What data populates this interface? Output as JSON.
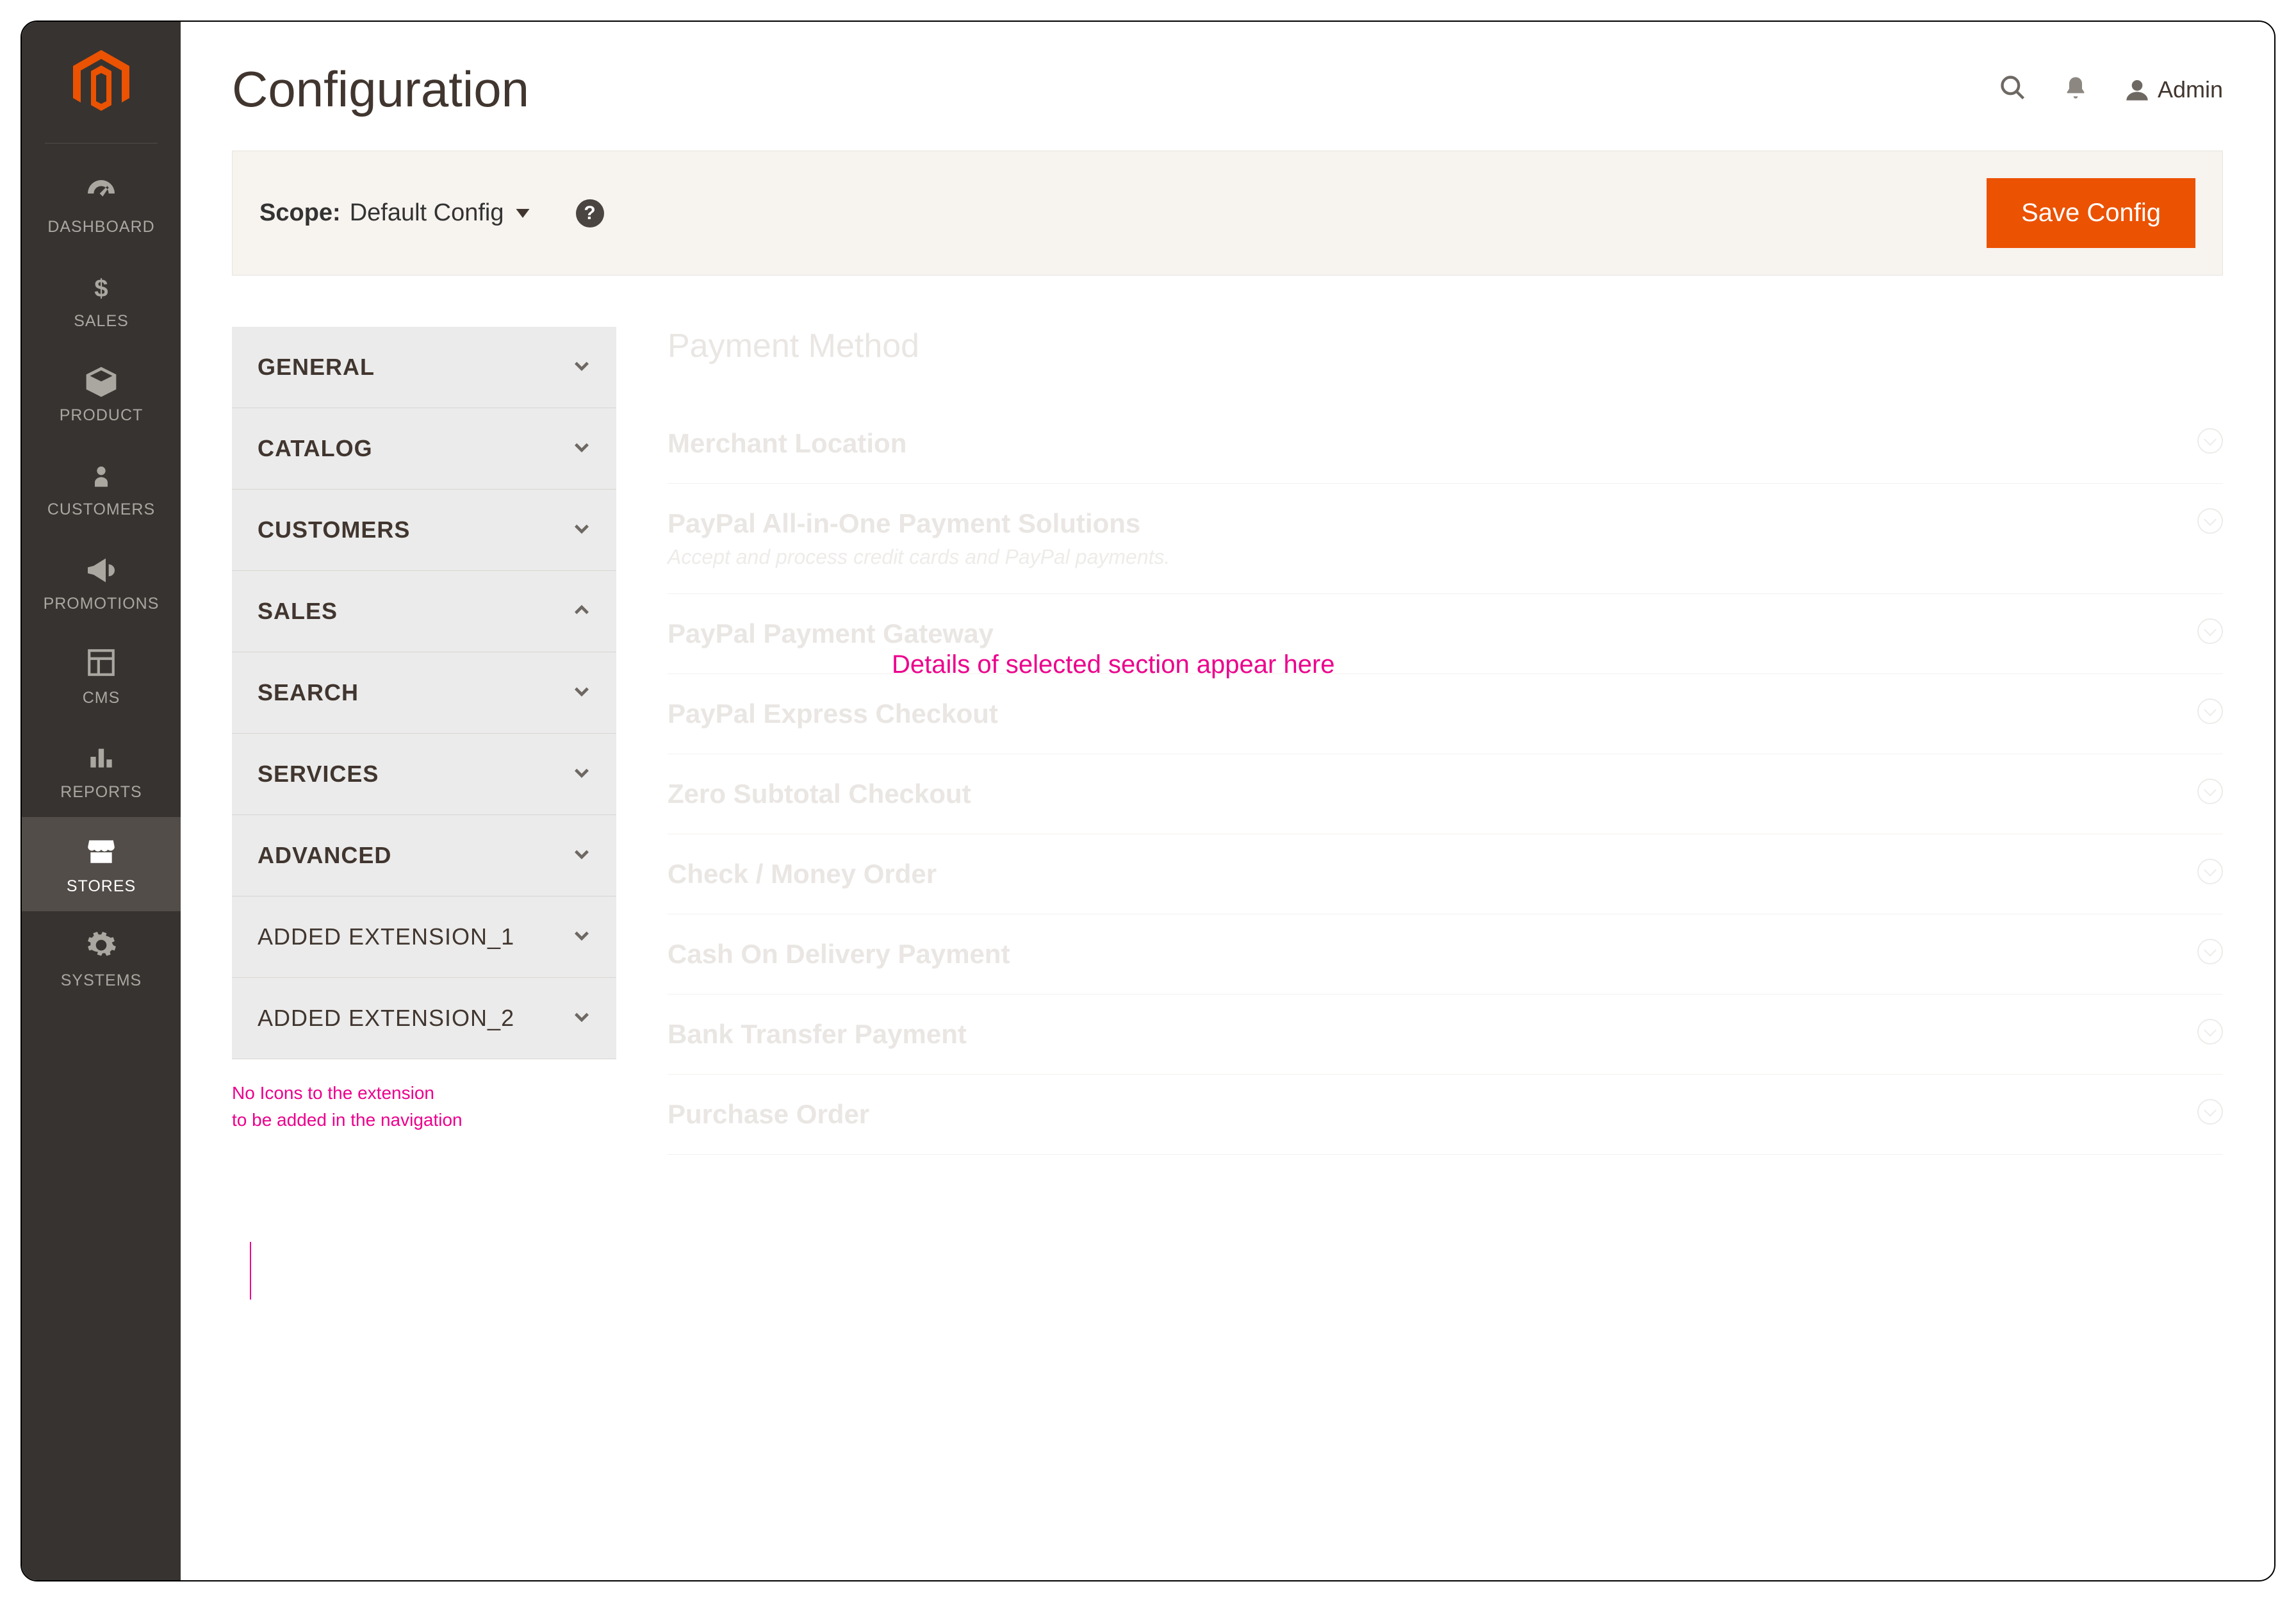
{
  "header": {
    "title": "Configuration",
    "user_label": "Admin"
  },
  "toolbar": {
    "scope_label": "Scope:",
    "scope_value": "Default Config",
    "save_label": "Save Config"
  },
  "sidebar": {
    "items": [
      {
        "label": "DASHBOARD",
        "icon": "dashboard-icon"
      },
      {
        "label": "SALES",
        "icon": "dollar-icon"
      },
      {
        "label": "PRODUCT",
        "icon": "box-icon"
      },
      {
        "label": "CUSTOMERS",
        "icon": "person-icon"
      },
      {
        "label": "PROMOTIONS",
        "icon": "megaphone-icon"
      },
      {
        "label": "CMS",
        "icon": "layout-icon"
      },
      {
        "label": "REPORTS",
        "icon": "barchart-icon"
      },
      {
        "label": "STORES",
        "icon": "storefront-icon"
      },
      {
        "label": "SYSTEMS",
        "icon": "gear-icon"
      }
    ],
    "active_index": 7
  },
  "config_nav": {
    "items": [
      {
        "label": "GENERAL",
        "expanded": false
      },
      {
        "label": "CATALOG",
        "expanded": false
      },
      {
        "label": "CUSTOMERS",
        "expanded": false
      },
      {
        "label": "SALES",
        "expanded": true
      },
      {
        "label": "SEARCH",
        "expanded": false
      },
      {
        "label": "SERVICES",
        "expanded": false
      },
      {
        "label": "ADVANCED",
        "expanded": false
      },
      {
        "label": "ADDED EXTENSION_1",
        "expanded": false,
        "ext": true
      },
      {
        "label": "ADDED EXTENSION_2",
        "expanded": false,
        "ext": true
      }
    ]
  },
  "detail": {
    "section_title": "Payment Method",
    "overlay_note": "Details of selected section appear here",
    "rows": [
      {
        "title": "Merchant Location"
      },
      {
        "title": "PayPal All-in-One Payment Solutions",
        "subtitle": "Accept and process credit cards and PayPal payments."
      },
      {
        "title": "PayPal Payment Gateway"
      },
      {
        "title": "PayPal Express Checkout"
      },
      {
        "title": "Zero Subtotal Checkout"
      },
      {
        "title": "Check / Money Order"
      },
      {
        "title": "Cash On Delivery Payment"
      },
      {
        "title": "Bank Transfer Payment"
      },
      {
        "title": "Purchase Order"
      }
    ]
  },
  "annotations": {
    "nav_note_line1": "No Icons to the extension",
    "nav_note_line2": "to be added in the navigation"
  },
  "colors": {
    "accent": "#eb5202",
    "annotation": "#ec008c",
    "sidebar_bg": "#373330"
  }
}
